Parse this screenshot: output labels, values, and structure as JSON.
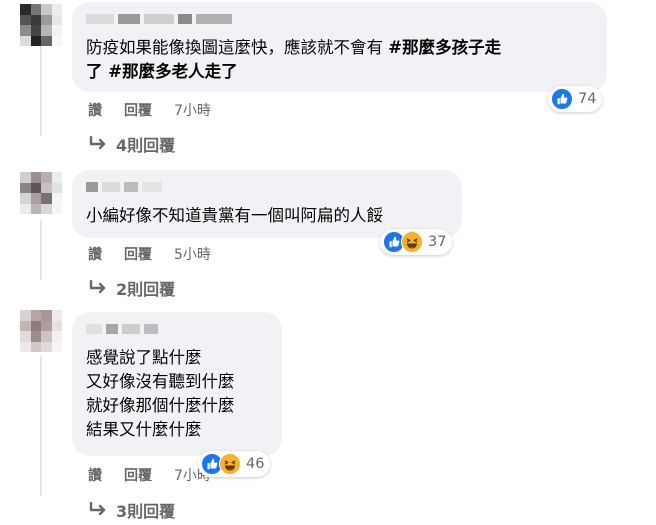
{
  "comments": [
    {
      "body_parts": [
        {
          "text": "防疫如果能像換圖這麼快，應該就不會有 ",
          "bold": false
        },
        {
          "text": "#那麼多孩子走",
          "bold": true
        },
        {
          "text": "\n",
          "bold": false
        },
        {
          "text": "了 #那麼多老人走了",
          "bold": true
        }
      ],
      "like_label": "讚",
      "reply_label": "回覆",
      "time": "7小時",
      "reactions": {
        "icons": [
          "like-icon"
        ],
        "count": "74"
      },
      "replies_label": "4則回覆"
    },
    {
      "body": "小編好像不知道貴黨有一個叫阿扁的人餒",
      "like_label": "讚",
      "reply_label": "回覆",
      "time": "5小時",
      "reactions": {
        "icons": [
          "like-icon",
          "haha-icon"
        ],
        "count": "37"
      },
      "replies_label": "2則回覆"
    },
    {
      "body": "感覺說了點什麼\n又好像沒有聽到什麼\n就好像那個什麼什麼\n結果又什麼什麼",
      "like_label": "讚",
      "reply_label": "回覆",
      "time": "7小時",
      "reactions": {
        "icons": [
          "like-icon",
          "haha-icon"
        ],
        "count": "46"
      },
      "replies_label": "3則回覆"
    }
  ],
  "colors": {
    "bubble": "#f0f2f5",
    "secondary_text": "#65676b",
    "like_blue": "#1877f2",
    "haha_yellow": "#f7b125"
  }
}
